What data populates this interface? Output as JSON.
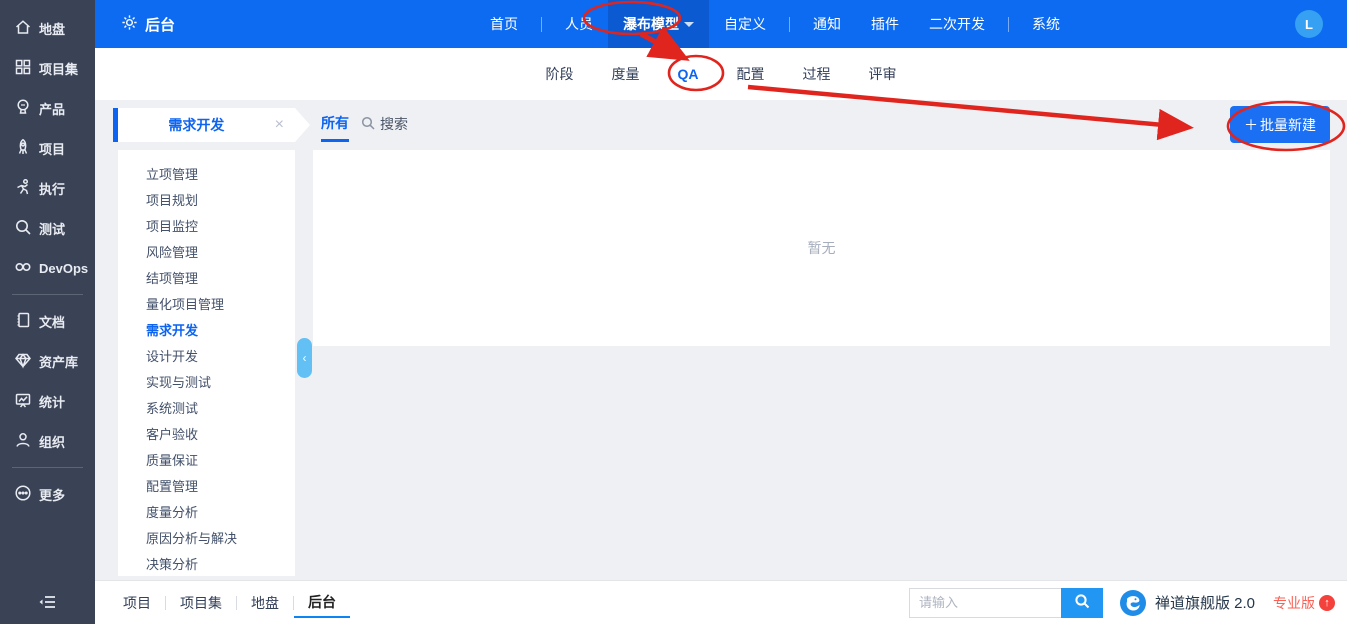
{
  "colors": {
    "topbar_blue": "#0c6bf0",
    "topbar_active_blue": "#0b5ad2",
    "sidebar_dark": "#3a4255",
    "accent_blue": "#0c64f0",
    "button_blue": "#1a6ff2",
    "search_button_blue": "#2196f3",
    "annotation_red": "#e0251f",
    "edition_red": "#fa6055",
    "gray_bg": "#eef0f3"
  },
  "icons": {
    "close": "×",
    "plus": "＋",
    "chevron_left": "‹",
    "up_arrow": "↑"
  },
  "sidebar": {
    "group1": [
      {
        "icon": "home-icon",
        "label": "地盘"
      },
      {
        "icon": "grid-icon",
        "label": "项目集"
      },
      {
        "icon": "product-icon",
        "label": "产品"
      },
      {
        "icon": "rocket-icon",
        "label": "项目"
      },
      {
        "icon": "runner-icon",
        "label": "执行"
      },
      {
        "icon": "magnifier-icon",
        "label": "测试"
      },
      {
        "icon": "infinity-icon",
        "label": "DevOps"
      }
    ],
    "group2": [
      {
        "icon": "document-icon",
        "label": "文档"
      },
      {
        "icon": "diamond-icon",
        "label": "资产库"
      },
      {
        "icon": "chart-board-icon",
        "label": "统计"
      },
      {
        "icon": "person-icon",
        "label": "组织"
      }
    ],
    "group3": [
      {
        "icon": "more-icon",
        "label": "更多"
      }
    ]
  },
  "topbar": {
    "brand": {
      "icon": "gear-icon",
      "label": "后台"
    },
    "nav": [
      {
        "label": "首页"
      },
      {
        "label": "人员"
      },
      {
        "label": "瀑布模型",
        "active": true,
        "dropdown": true
      },
      {
        "label": "自定义"
      },
      {
        "label": "通知"
      },
      {
        "label": "插件"
      },
      {
        "label": "二次开发"
      },
      {
        "label": "系统"
      }
    ],
    "avatar": "L"
  },
  "subnav": {
    "items": [
      {
        "label": "阶段"
      },
      {
        "label": "度量"
      },
      {
        "label": "QA",
        "active": true
      },
      {
        "label": "配置"
      },
      {
        "label": "过程"
      },
      {
        "label": "评审"
      }
    ]
  },
  "panel": {
    "title": "需求开发",
    "items": [
      "立项管理",
      "项目规划",
      "项目监控",
      "风险管理",
      "结项管理",
      "量化项目管理",
      "需求开发",
      "设计开发",
      "实现与测试",
      "系统测试",
      "客户验收",
      "质量保证",
      "配置管理",
      "度量分析",
      "原因分析与解决",
      "决策分析"
    ],
    "active_item": "需求开发"
  },
  "toolbar": {
    "all_tab": "所有",
    "search_label": "搜索",
    "bulk_button_label": "批量新建"
  },
  "content": {
    "empty_text": "暂无"
  },
  "bottombar": {
    "tabs": [
      {
        "label": "项目"
      },
      {
        "label": "项目集"
      },
      {
        "label": "地盘"
      },
      {
        "label": "后台",
        "active": true
      }
    ],
    "search": {
      "placeholder": "请输入"
    },
    "brand": "禅道旗舰版 2.0",
    "edition": "专业版"
  }
}
